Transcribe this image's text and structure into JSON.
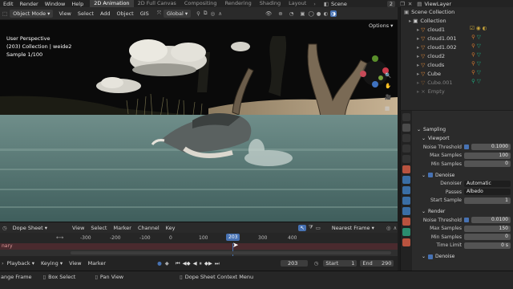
{
  "topbar": {
    "menus": [
      "Edit",
      "Render",
      "Window",
      "Help"
    ],
    "workspaces": [
      "2D Animation",
      "2D Full Canvas",
      "Compositing",
      "Rendering",
      "Shading",
      "Layout"
    ],
    "active_workspace": "2D Animation",
    "scene_label": "Scene",
    "scene_count": "2",
    "viewlayer_label": "ViewLayer"
  },
  "viewport_header": {
    "mode": "Object Mode",
    "menus": [
      "View",
      "Select",
      "Add",
      "Object",
      "GIS"
    ],
    "transform": "Global",
    "options_label": "Options"
  },
  "viewport": {
    "perspective": "User Perspective",
    "collection": "(203) Collection | weide2",
    "sample": "Sample 1/100"
  },
  "outliner": {
    "title": "Scene Collection",
    "items": [
      {
        "name": "Collection",
        "indent": 0
      },
      {
        "name": "cloud1",
        "indent": 1
      },
      {
        "name": "cloud1.001",
        "indent": 1
      },
      {
        "name": "cloud1.002",
        "indent": 1
      },
      {
        "name": "cloud2",
        "indent": 1
      },
      {
        "name": "clouds",
        "indent": 1
      },
      {
        "name": "Cube",
        "indent": 1
      },
      {
        "name": "Cube.001",
        "indent": 1
      },
      {
        "name": "Empty",
        "indent": 1
      }
    ]
  },
  "properties": {
    "sampling": {
      "title": "Sampling",
      "viewport_title": "Viewport",
      "noise_threshold_label": "Noise Threshold",
      "noise_threshold": "0.1000",
      "max_samples_label": "Max Samples",
      "max_samples": "100",
      "min_samples_label": "Min Samples",
      "min_samples": "0"
    },
    "denoise_viewport": {
      "title": "Denoise",
      "denoiser_label": "Denoiser",
      "denoiser": "Automatic",
      "passes_label": "Passes",
      "passes": "Albedo",
      "start_sample_label": "Start Sample",
      "start_sample": "1"
    },
    "render": {
      "title": "Render",
      "noise_threshold_label": "Noise Threshold",
      "noise_threshold": "0.0100",
      "max_samples_label": "Max Samples",
      "max_samples": "150",
      "min_samples_label": "Min Samples",
      "min_samples": "0",
      "time_limit_label": "Time Limit",
      "time_limit": "0 s"
    },
    "denoise_render": {
      "title": "Denoise"
    }
  },
  "dopesheet": {
    "editor": "Dope Sheet",
    "menus": [
      "View",
      "Select",
      "Marker",
      "Channel",
      "Key"
    ],
    "interpolation": "Nearest Frame",
    "ruler_ticks": [
      "-300",
      "-200",
      "-100",
      "0",
      "100",
      "200",
      "300",
      "400"
    ],
    "current_frame_marker": "203",
    "channel_label": "nary"
  },
  "timeline": {
    "menus": [
      "Playback",
      "Keying",
      "View",
      "Marker"
    ],
    "current_frame": "203",
    "start_label": "Start",
    "start": "1",
    "end_label": "End",
    "end": "290"
  },
  "statusbar": {
    "items": [
      "ange Frame",
      "Box Select",
      "Pan View",
      "Dope Sheet Context Menu"
    ]
  },
  "colors": {
    "accent": "#4772b3",
    "frame_marker": "#4772b3",
    "header_bg": "#2a2a2a",
    "panel_bg": "#2b2b2b"
  }
}
